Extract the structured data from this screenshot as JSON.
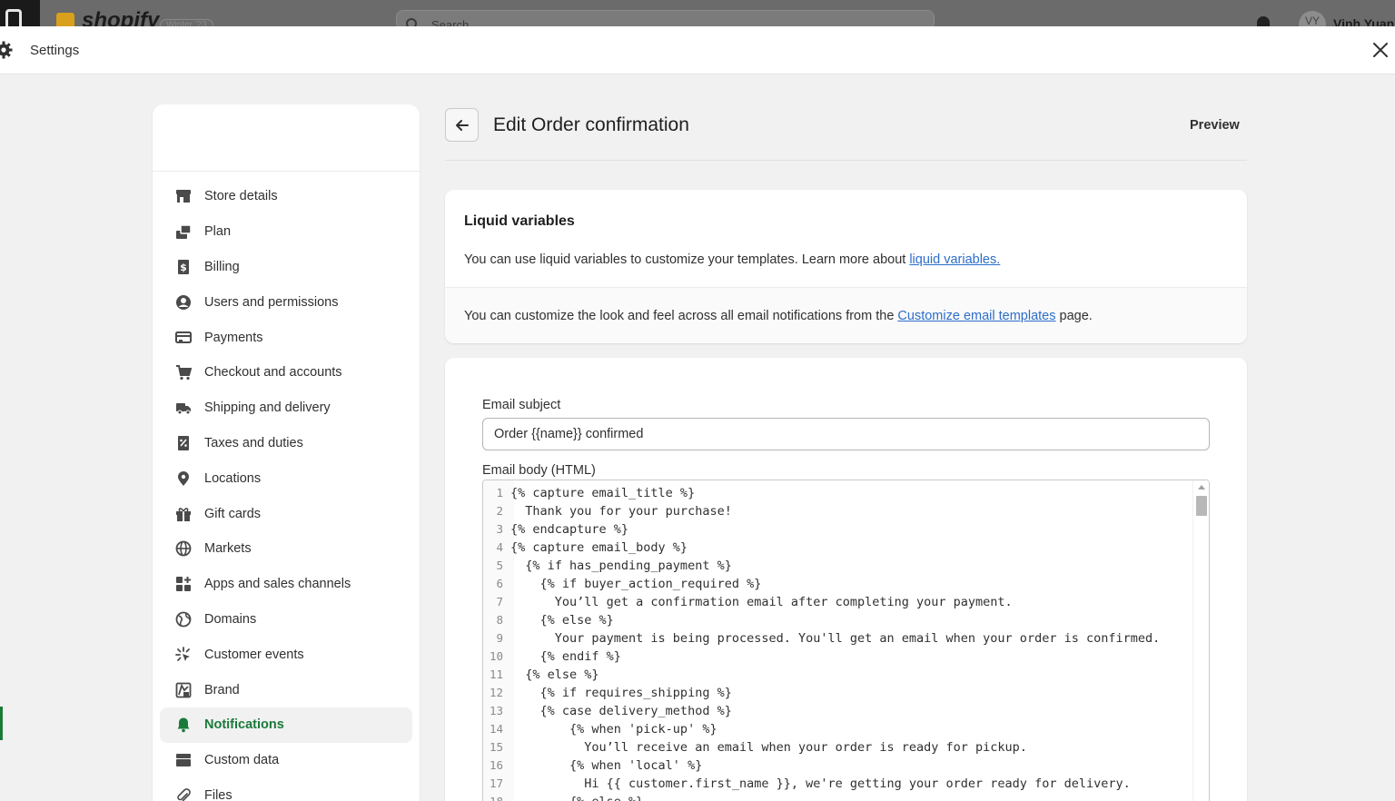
{
  "topbar": {
    "brand": "shopify",
    "brand_sub": "Winter '23",
    "search_placeholder": "Search",
    "avatar_initials": "VY",
    "user_name": "Vinh Yuan"
  },
  "modal": {
    "title": "Settings"
  },
  "sidebar": {
    "items": [
      {
        "label": "Store details",
        "icon": "store-icon"
      },
      {
        "label": "Plan",
        "icon": "plan-icon"
      },
      {
        "label": "Billing",
        "icon": "billing-icon"
      },
      {
        "label": "Users and permissions",
        "icon": "user-icon"
      },
      {
        "label": "Payments",
        "icon": "payments-icon"
      },
      {
        "label": "Checkout and accounts",
        "icon": "cart-icon"
      },
      {
        "label": "Shipping and delivery",
        "icon": "truck-icon"
      },
      {
        "label": "Taxes and duties",
        "icon": "tax-icon"
      },
      {
        "label": "Locations",
        "icon": "location-icon"
      },
      {
        "label": "Gift cards",
        "icon": "gift-icon"
      },
      {
        "label": "Markets",
        "icon": "globe-icon"
      },
      {
        "label": "Apps and sales channels",
        "icon": "apps-icon"
      },
      {
        "label": "Domains",
        "icon": "domains-icon"
      },
      {
        "label": "Customer events",
        "icon": "sparkle-icon"
      },
      {
        "label": "Brand",
        "icon": "brand-icon"
      },
      {
        "label": "Notifications",
        "icon": "bell-icon",
        "active": true
      },
      {
        "label": "Custom data",
        "icon": "custom-data-icon"
      },
      {
        "label": "Files",
        "icon": "paperclip-icon"
      }
    ]
  },
  "main": {
    "title": "Edit Order confirmation",
    "preview_label": "Preview",
    "liquid": {
      "heading": "Liquid variables",
      "text1_pre": "You can use liquid variables to customize your templates. Learn more about ",
      "text1_link": "liquid variables.",
      "text2_pre": "You can customize the look and feel across all email notifications from the ",
      "text2_link": "Customize email templates",
      "text2_post": " page."
    },
    "email": {
      "subject_label": "Email subject",
      "subject_value": "Order {{name}} confirmed",
      "body_label": "Email body (HTML)",
      "code_lines": [
        "{% capture email_title %}",
        "  Thank you for your purchase!",
        "{% endcapture %}",
        "{% capture email_body %}",
        "  {% if has_pending_payment %}",
        "    {% if buyer_action_required %}",
        "      You’ll get a confirmation email after completing your payment.",
        "    {% else %}",
        "      Your payment is being processed. You'll get an email when your order is confirmed.",
        "    {% endif %}",
        "  {% else %}",
        "    {% if requires_shipping %}",
        "    {% case delivery_method %}",
        "        {% when 'pick-up' %}",
        "          You’ll receive an email when your order is ready for pickup.",
        "        {% when 'local' %}",
        "          Hi {{ customer.first_name }}, we're getting your order ready for delivery.",
        "        {% else %}"
      ]
    }
  },
  "colors": {
    "accent_green": "#1a7a3a",
    "link_blue": "#2c6ecb"
  }
}
